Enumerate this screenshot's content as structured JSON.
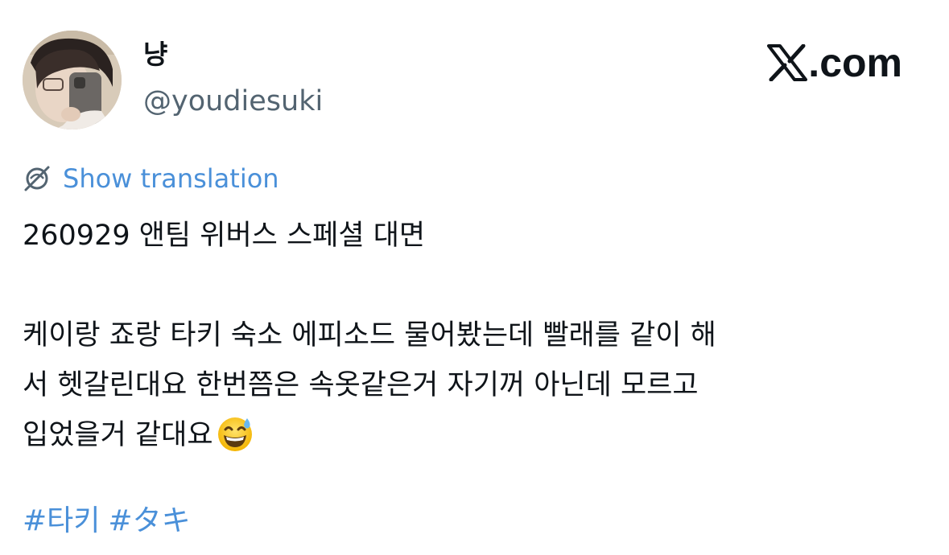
{
  "user": {
    "display_name": "냥",
    "handle": "@youdiesuki",
    "avatar_icon": "profile-photo"
  },
  "brand": {
    "logo_icon": "x-logo-icon",
    "label": ".com"
  },
  "translation": {
    "icon": "globe-icon",
    "label": "Show translation"
  },
  "tweet": {
    "lines": [
      "260929 앤팀 위버스 스페셜 대면",
      "",
      "케이랑 죠랑 타키 숙소 에피소드 물어봤는데 빨래를 같이 해",
      "서 헷갈린대요 한번쯤은 속옷같은거 자기꺼 아닌데 모르고",
      "입었을거 같대요"
    ],
    "emoji_icon": "grinning-face-with-sweat-emoji"
  },
  "hashtags": [
    "#타키",
    "#タキ"
  ],
  "colors": {
    "link": "#4a90d9",
    "text": "#0f1419",
    "secondary": "#536471"
  }
}
